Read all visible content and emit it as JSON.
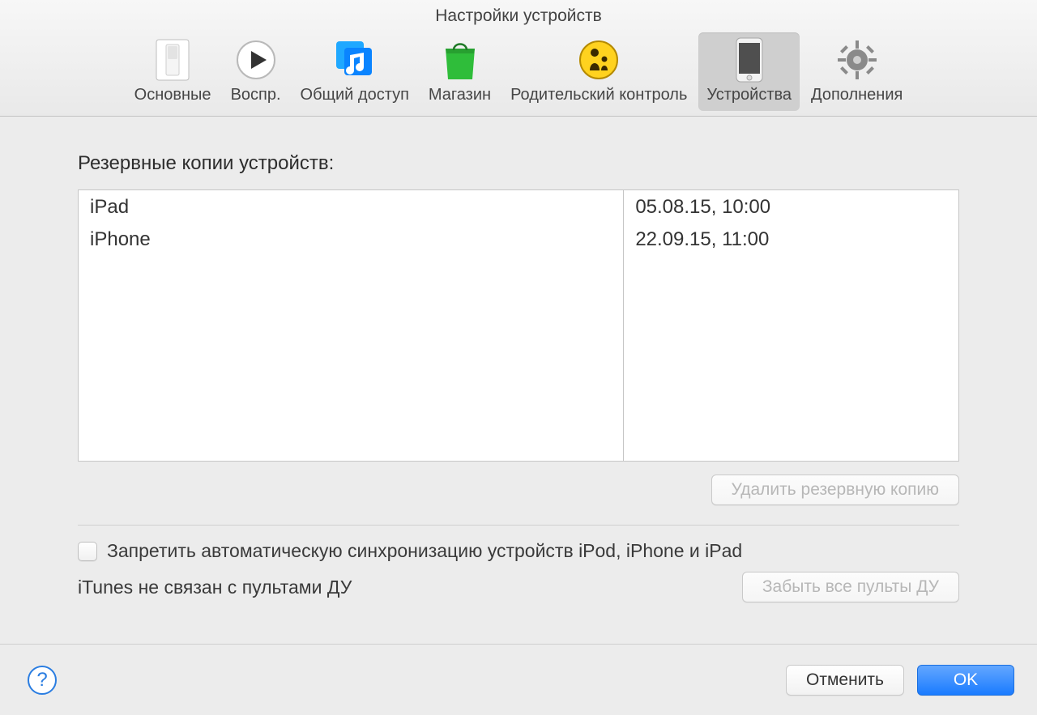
{
  "window": {
    "title": "Настройки устройств"
  },
  "tabs": [
    {
      "id": "general",
      "label": "Основные",
      "active": false
    },
    {
      "id": "playback",
      "label": "Воспр.",
      "active": false
    },
    {
      "id": "sharing",
      "label": "Общий доступ",
      "active": false
    },
    {
      "id": "store",
      "label": "Магазин",
      "active": false
    },
    {
      "id": "parental",
      "label": "Родительский контроль",
      "active": false
    },
    {
      "id": "devices",
      "label": "Устройства",
      "active": true
    },
    {
      "id": "advanced",
      "label": "Дополнения",
      "active": false
    }
  ],
  "main": {
    "section_label": "Резервные копии устройств:",
    "rows": [
      {
        "device": "iPad",
        "date": "05.08.15, 10:00"
      },
      {
        "device": "iPhone",
        "date": "22.09.15, 11:00"
      }
    ],
    "delete_backup_label": "Удалить резервную копию",
    "prevent_sync_label": "Запретить автоматическую синхронизацию устройств iPod, iPhone и iPad",
    "prevent_sync_checked": false,
    "remotes_label": "iTunes не связан с пультами ДУ",
    "forget_remotes_label": "Забыть все пульты ДУ"
  },
  "footer": {
    "help_label": "?",
    "cancel_label": "Отменить",
    "ok_label": "OK"
  }
}
